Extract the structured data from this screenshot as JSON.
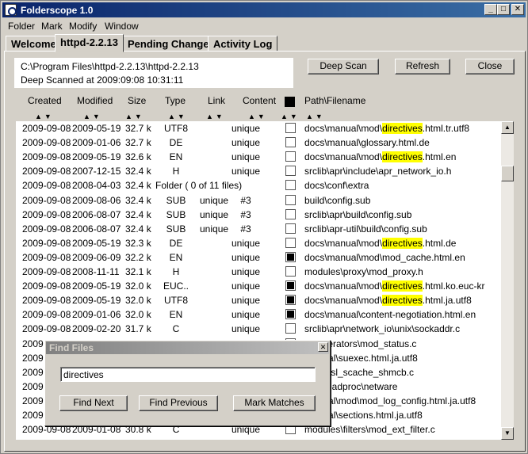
{
  "window": {
    "title": "Folderscope 1.0",
    "icon": "folderscope-app-icon",
    "controls": [
      "minimize-icon",
      "maximize-icon",
      "close-icon"
    ]
  },
  "menu": [
    "Folder",
    "Mark",
    "Modify",
    "Window"
  ],
  "tabs": [
    "Welcome",
    "httpd-2.2.13",
    "Pending Changes",
    "Activity Log"
  ],
  "active_tab": "httpd-2.2.13",
  "info": {
    "path": "C:\\Program Files\\httpd-2.2.13\\httpd-2.2.13",
    "scan_status": "Deep Scanned at 2009:09:08 10:31:11"
  },
  "buttons": {
    "deep_scan": "Deep Scan",
    "refresh": "Refresh",
    "close": "Close"
  },
  "columns": {
    "created": "Created",
    "modified": "Modified",
    "size": "Size",
    "type": "Type",
    "link": "Link",
    "content": "Content",
    "path": "Path\\Filename"
  },
  "sort_arrows": "▲▼",
  "highlight_term": "directives",
  "rows": [
    {
      "created": "2009-09-08",
      "modified": "2009-05-19",
      "size": "32.7 k",
      "type": "UTF8",
      "link": "",
      "content": "unique",
      "marked": false,
      "path_pre": "docs\\manual\\mod\\",
      "path_hl": "directives",
      "path_post": ".html.tr.utf8"
    },
    {
      "created": "2009-09-08",
      "modified": "2009-01-06",
      "size": "32.7 k",
      "type": "DE",
      "link": "",
      "content": "unique",
      "marked": false,
      "path_pre": "docs\\manual\\glossary.html.de",
      "path_hl": "",
      "path_post": ""
    },
    {
      "created": "2009-09-08",
      "modified": "2009-05-19",
      "size": "32.6 k",
      "type": "EN",
      "link": "",
      "content": "unique",
      "marked": false,
      "path_pre": "docs\\manual\\mod\\",
      "path_hl": "directives",
      "path_post": ".html.en"
    },
    {
      "created": "2009-09-08",
      "modified": "2007-12-15",
      "size": "32.4 k",
      "type": "H",
      "link": "",
      "content": "unique",
      "marked": false,
      "path_pre": "srclib\\apr\\include\\apr_network_io.h",
      "path_hl": "",
      "path_post": ""
    },
    {
      "created": "2009-09-08",
      "modified": "2008-04-03",
      "size": "32.4 k",
      "type": "Folder ( 0 of 11 files)",
      "link": "",
      "content": "",
      "marked": false,
      "path_pre": "docs\\conf\\extra",
      "path_hl": "",
      "path_post": ""
    },
    {
      "created": "2009-09-08",
      "modified": "2009-08-06",
      "size": "32.4 k",
      "type": "SUB",
      "link": "unique",
      "content": "#3",
      "marked": false,
      "path_pre": "build\\config.sub",
      "path_hl": "",
      "path_post": ""
    },
    {
      "created": "2009-09-08",
      "modified": "2006-08-07",
      "size": "32.4 k",
      "type": "SUB",
      "link": "unique",
      "content": "#3",
      "marked": false,
      "path_pre": "srclib\\apr\\build\\config.sub",
      "path_hl": "",
      "path_post": ""
    },
    {
      "created": "2009-09-08",
      "modified": "2006-08-07",
      "size": "32.4 k",
      "type": "SUB",
      "link": "unique",
      "content": "#3",
      "marked": false,
      "path_pre": "srclib\\apr-util\\build\\config.sub",
      "path_hl": "",
      "path_post": ""
    },
    {
      "created": "2009-09-08",
      "modified": "2009-05-19",
      "size": "32.3 k",
      "type": "DE",
      "link": "",
      "content": "unique",
      "marked": false,
      "path_pre": "docs\\manual\\mod\\",
      "path_hl": "directives",
      "path_post": ".html.de"
    },
    {
      "created": "2009-09-08",
      "modified": "2009-06-09",
      "size": "32.2 k",
      "type": "EN",
      "link": "",
      "content": "unique",
      "marked": true,
      "path_pre": "docs\\manual\\mod\\mod_cache.html.en",
      "path_hl": "",
      "path_post": ""
    },
    {
      "created": "2009-09-08",
      "modified": "2008-11-11",
      "size": "32.1 k",
      "type": "H",
      "link": "",
      "content": "unique",
      "marked": false,
      "path_pre": "modules\\proxy\\mod_proxy.h",
      "path_hl": "",
      "path_post": ""
    },
    {
      "created": "2009-09-08",
      "modified": "2009-05-19",
      "size": "32.0 k",
      "type": "EUC..",
      "link": "",
      "content": "unique",
      "marked": true,
      "path_pre": "docs\\manual\\mod\\",
      "path_hl": "directives",
      "path_post": ".html.ko.euc-kr"
    },
    {
      "created": "2009-09-08",
      "modified": "2009-05-19",
      "size": "32.0 k",
      "type": "UTF8",
      "link": "",
      "content": "unique",
      "marked": true,
      "path_pre": "docs\\manual\\mod\\",
      "path_hl": "directives",
      "path_post": ".html.ja.utf8"
    },
    {
      "created": "2009-09-08",
      "modified": "2009-01-06",
      "size": "32.0 k",
      "type": "EN",
      "link": "",
      "content": "unique",
      "marked": true,
      "path_pre": "docs\\manual\\content-negotiation.html.en",
      "path_hl": "",
      "path_post": ""
    },
    {
      "created": "2009-09-08",
      "modified": "2009-02-20",
      "size": "31.7 k",
      "type": "C",
      "link": "",
      "content": "unique",
      "marked": false,
      "path_pre": "srclib\\apr\\network_io\\unix\\sockaddr.c",
      "path_hl": "",
      "path_post": ""
    },
    {
      "created": "2009",
      "modified": "",
      "size": "",
      "type": "",
      "link": "",
      "content": "",
      "marked": false,
      "path_pre": "s\\generators\\mod_status.c",
      "path_hl": "",
      "path_post": ""
    },
    {
      "created": "2009",
      "modified": "",
      "size": "",
      "type": "",
      "link": "",
      "content": "",
      "marked": false,
      "path_pre": "manual\\suexec.html.ja.utf8",
      "path_hl": "",
      "path_post": ""
    },
    {
      "created": "2009",
      "modified": "",
      "size": "",
      "type": "",
      "link": "",
      "content": "",
      "marked": false,
      "path_pre": "s\\ssl\\ssl_scache_shmcb.c",
      "path_hl": "",
      "path_post": ""
    },
    {
      "created": "2009",
      "modified": "",
      "size": "",
      "type": "",
      "link": "",
      "content": "",
      "marked": false,
      "path_pre": "pr\\threadproc\\netware",
      "path_hl": "",
      "path_post": ""
    },
    {
      "created": "2009",
      "modified": "",
      "size": "",
      "type": "",
      "link": "",
      "content": "",
      "marked": false,
      "path_pre": "manual\\mod\\mod_log_config.html.ja.utf8",
      "path_hl": "",
      "path_post": ""
    },
    {
      "created": "2009",
      "modified": "",
      "size": "",
      "type": "",
      "link": "",
      "content": "",
      "marked": false,
      "path_pre": "manual\\sections.html.ja.utf8",
      "path_hl": "",
      "path_post": ""
    },
    {
      "created": "2009-09-08",
      "modified": "2009-01-08",
      "size": "30.8 k",
      "type": "C",
      "link": "",
      "content": "unique",
      "marked": false,
      "path_pre": "modules\\filters\\mod_ext_filter.c",
      "path_hl": "",
      "path_post": ""
    }
  ],
  "find_dialog": {
    "title": "Find Files",
    "query": "directives",
    "find_next": "Find Next",
    "find_previous": "Find Previous",
    "mark_matches": "Mark Matches",
    "close_icon": "close-icon"
  },
  "scrollbar": {
    "up": "scroll-up-icon",
    "down": "scroll-down-icon"
  }
}
